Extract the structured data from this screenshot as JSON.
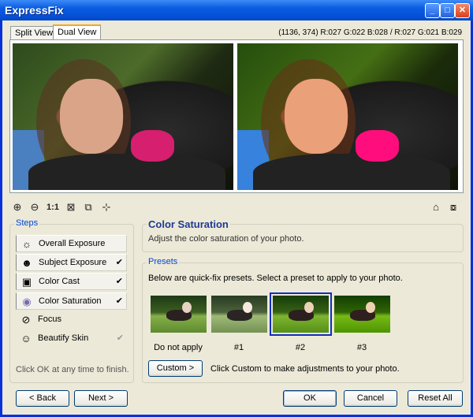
{
  "window": {
    "title": "ExpressFix",
    "minimize": "_",
    "maximize": "□",
    "close": "✕"
  },
  "tabs": [
    {
      "label": "Split View"
    },
    {
      "label": "Dual View",
      "active": true
    }
  ],
  "pixel_readout": "(1136, 374) R:027 G:022 B:028 / R:027 G:021 B:029",
  "toolbar": {
    "icons": [
      "zoom-in-icon",
      "zoom-out-icon",
      "actual-size-icon",
      "fit-window-icon",
      "zoom-region-icon",
      "pan-icon"
    ],
    "actual_size_label": "1:1"
  },
  "steps": {
    "title": "Steps",
    "items": [
      {
        "label": "Overall Exposure",
        "checked": false,
        "icon": "exposure-icon"
      },
      {
        "label": "Subject Exposure",
        "checked": true,
        "icon": "subject-exposure-icon"
      },
      {
        "label": "Color Cast",
        "checked": true,
        "icon": "color-cast-icon"
      },
      {
        "label": "Color Saturation",
        "checked": true,
        "icon": "color-saturation-icon"
      },
      {
        "label": "Focus",
        "checked": false,
        "icon": "focus-icon"
      },
      {
        "label": "Beautify Skin",
        "checked": true,
        "icon": "beautify-skin-icon"
      }
    ],
    "hint": "Click OK at any time to finish."
  },
  "section": {
    "title": "Color Saturation",
    "description": "Adjust the color saturation of your photo."
  },
  "presets": {
    "title": "Presets",
    "description": "Below are quick-fix presets. Select a preset to apply to your photo.",
    "items": [
      {
        "label": "Do not apply"
      },
      {
        "label": "#1"
      },
      {
        "label": "#2",
        "selected": true
      },
      {
        "label": "#3"
      }
    ],
    "custom_button": "Custom >",
    "custom_hint": "Click Custom to make adjustments to your photo."
  },
  "buttons": {
    "back": "< Back",
    "next": "Next >",
    "ok": "OK",
    "cancel": "Cancel",
    "reset_all": "Reset All"
  },
  "check": "✔"
}
